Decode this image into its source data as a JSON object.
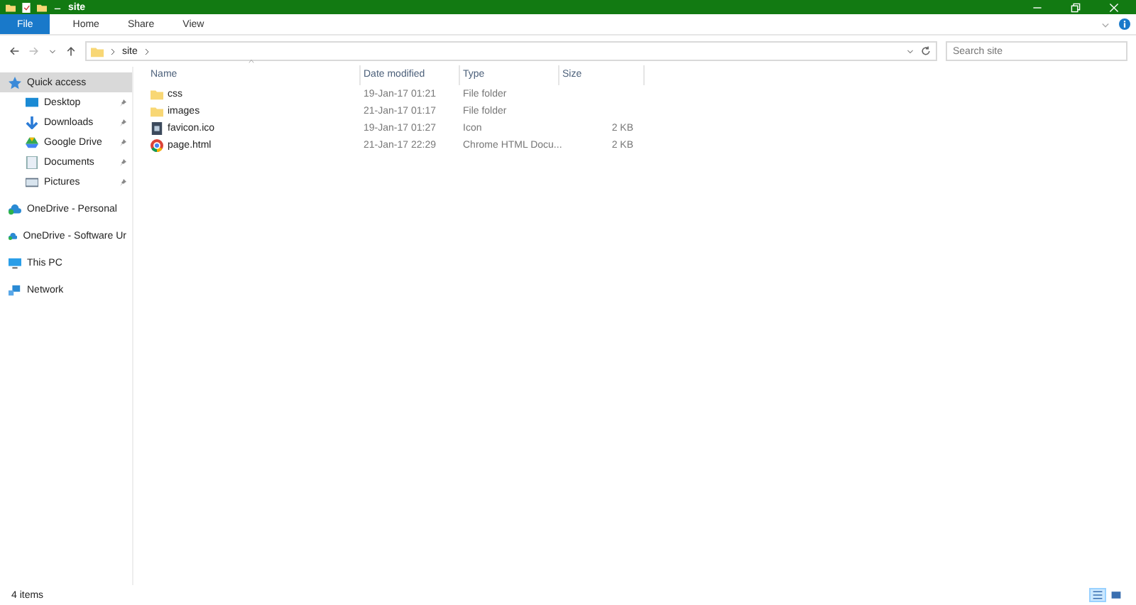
{
  "window": {
    "title": "site"
  },
  "ribbon": {
    "tabs": [
      {
        "label": "File",
        "selected": false,
        "kind": "file"
      },
      {
        "label": "Home",
        "selected": false,
        "kind": "tab"
      },
      {
        "label": "Share",
        "selected": false,
        "kind": "tab"
      },
      {
        "label": "View",
        "selected": false,
        "kind": "tab"
      }
    ]
  },
  "address": {
    "path": [
      "site"
    ],
    "search": {
      "placeholder": "Search site"
    }
  },
  "sidebar": {
    "items": [
      {
        "label": "Quick access",
        "kind": "star",
        "selected": true,
        "children": [
          {
            "label": "Desktop",
            "kind": "desktop",
            "pinned": true,
            "selected": false
          },
          {
            "label": "Downloads",
            "kind": "download",
            "pinned": true,
            "selected": false
          },
          {
            "label": "Google Drive",
            "kind": "drive",
            "pinned": true,
            "selected": false
          },
          {
            "label": "Documents",
            "kind": "documents",
            "pinned": true,
            "selected": false
          },
          {
            "label": "Pictures",
            "kind": "pictures",
            "pinned": true,
            "selected": false
          }
        ]
      },
      {
        "label": "OneDrive - Personal",
        "kind": "cloud",
        "selected": false
      },
      {
        "label": "OneDrive - Software Ur",
        "kind": "cloud",
        "selected": false
      },
      {
        "label": "This PC",
        "kind": "pc",
        "selected": false
      },
      {
        "label": "Network",
        "kind": "network",
        "selected": false
      }
    ]
  },
  "table": {
    "columns": [
      "Name",
      "Date modified",
      "Type",
      "Size"
    ],
    "rows": [
      {
        "kind": "folder",
        "name": "css",
        "date": "19-Jan-17 01:21",
        "type": "File folder",
        "size": ""
      },
      {
        "kind": "folder",
        "name": "images",
        "date": "21-Jan-17 01:17",
        "type": "File folder",
        "size": ""
      },
      {
        "kind": "ico",
        "name": "favicon.ico",
        "date": "19-Jan-17 01:27",
        "type": "Icon",
        "size": "2 KB"
      },
      {
        "kind": "chrome",
        "name": "page.html",
        "date": "21-Jan-17 22:29",
        "type": "Chrome HTML Docu...",
        "size": "2 KB"
      }
    ]
  },
  "status_bar": {
    "text": "4 items",
    "views": [
      {
        "kind": "details",
        "selected": true
      },
      {
        "kind": "large",
        "selected": false
      }
    ]
  }
}
